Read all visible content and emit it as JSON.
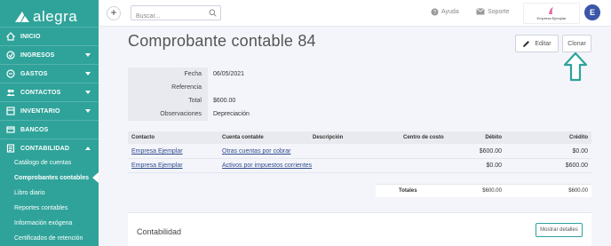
{
  "brand": {
    "name": "alegra",
    "accent": "#2fa39a"
  },
  "sidebar": {
    "items": [
      {
        "label": "INICIO",
        "icon": "home-icon"
      },
      {
        "label": "INGRESOS",
        "icon": "income-icon"
      },
      {
        "label": "GASTOS",
        "icon": "expenses-icon"
      },
      {
        "label": "CONTACTOS",
        "icon": "contacts-icon"
      },
      {
        "label": "INVENTARIO",
        "icon": "inventory-icon"
      },
      {
        "label": "BANCOS",
        "icon": "bank-icon"
      },
      {
        "label": "CONTABILIDAD",
        "icon": "accounting-icon"
      }
    ],
    "subitems": [
      {
        "label": "Catálogo de cuentas"
      },
      {
        "label": "Comprobantes contables"
      },
      {
        "label": "Libro diario"
      },
      {
        "label": "Reportes contables"
      },
      {
        "label": "Información exógena"
      },
      {
        "label": "Certificados de retención"
      }
    ]
  },
  "topbar": {
    "new_button": "+",
    "search_placeholder": "Buscar...",
    "help_label": "Ayuda",
    "support_label": "Soporte",
    "company_name": "Empresa Ejemplar",
    "avatar_initial": "E"
  },
  "page": {
    "title": "Comprobante contable 84",
    "edit_label": "Editar",
    "clone_label": "Clonar"
  },
  "info": {
    "fecha_label": "Fecha",
    "fecha_value": "06/05/2021",
    "referencia_label": "Referencia",
    "referencia_value": "",
    "total_label": "Total",
    "total_value": "$600.00",
    "observaciones_label": "Observaciones",
    "observaciones_value": "Depreciación"
  },
  "table": {
    "headers": [
      "Contacto",
      "Cuenta contable",
      "Descripción",
      "Centro de costo",
      "Débito",
      "Crédito"
    ],
    "rows": [
      {
        "contacto": "Empresa Ejemplar",
        "cuenta": "Otras cuentas por cobrar",
        "descripcion": "",
        "centro": "",
        "debito": "$600.00",
        "credito": "$0.00"
      },
      {
        "contacto": "Empresa Ejemplar",
        "cuenta": "Activos por impuestos corrientes",
        "descripcion": "",
        "centro": "",
        "debito": "$0.00",
        "credito": "$600.00"
      }
    ],
    "totals": {
      "label": "Totales",
      "debito": "$600.00",
      "credito": "$600.00"
    }
  },
  "accounting_card": {
    "title": "Contabilidad",
    "details_button": "Mostrar detalles"
  }
}
